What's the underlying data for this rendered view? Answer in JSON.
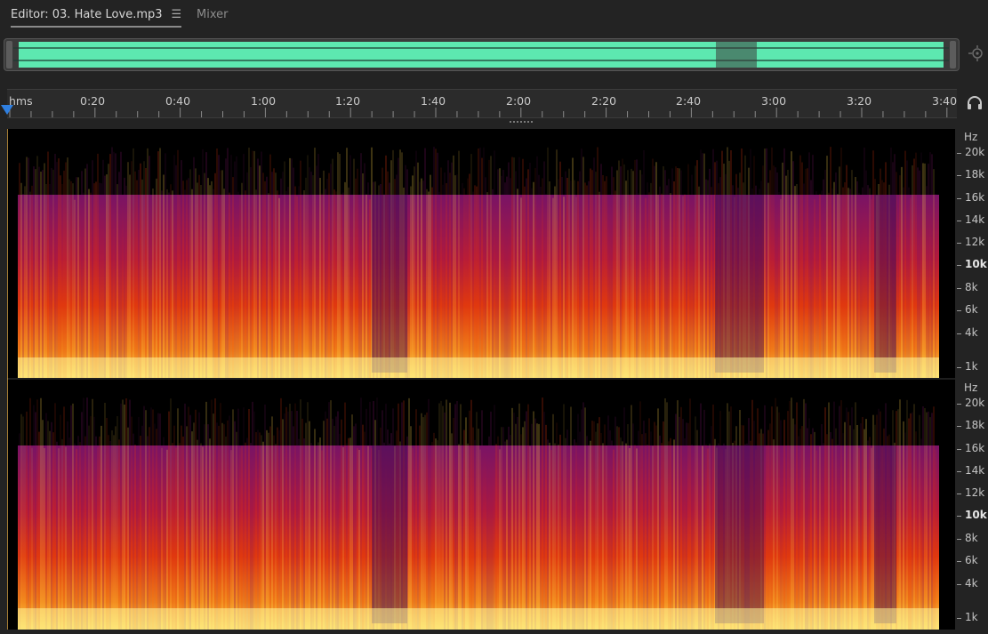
{
  "tabs": {
    "editor_label": "Editor: 03. Hate Love.mp3",
    "editor_menu_icon": "hamburger-menu-icon",
    "mixer_label": "Mixer"
  },
  "overview": {
    "waveform_color": "#5de8b0"
  },
  "ruler": {
    "labels": [
      "hms",
      "0:20",
      "0:40",
      "1:00",
      "1:20",
      "1:40",
      "2:00",
      "2:20",
      "2:40",
      "3:00",
      "3:20",
      "3:40"
    ],
    "playhead_color": "#2f7fe0"
  },
  "frequency_scale": {
    "unit": "Hz",
    "labels": [
      "20k",
      "18k",
      "16k",
      "14k",
      "12k",
      "10k",
      "8k",
      "6k",
      "4k",
      "1k"
    ]
  },
  "spectral": {
    "colors": [
      "#000000",
      "#3a0b55",
      "#7a1465",
      "#b51a3a",
      "#e0380f",
      "#f2841a",
      "#fbd24a",
      "#fff59a"
    ]
  },
  "icons": {
    "zoom": "zoom-navigate-icon",
    "monitor": "headphones-icon",
    "playhead": "playhead-marker-icon"
  }
}
